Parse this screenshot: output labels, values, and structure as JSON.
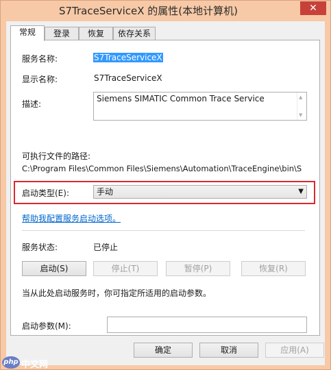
{
  "window": {
    "title": "S7TraceServiceX 的属性(本地计算机)",
    "close_glyph": "✕"
  },
  "tabs": [
    {
      "label": "常规",
      "active": true
    },
    {
      "label": "登录",
      "active": false
    },
    {
      "label": "恢复",
      "active": false
    },
    {
      "label": "依存关系",
      "active": false
    }
  ],
  "general": {
    "service_name_label": "服务名称:",
    "service_name_value": "S7TraceServiceX",
    "display_name_label": "显示名称:",
    "display_name_value": "S7TraceServiceX",
    "description_label": "描述:",
    "description_value": "Siemens SIMATIC Common Trace Service",
    "exe_path_label": "可执行文件的路径:",
    "exe_path_value": "C:\\Program Files\\Common Files\\Siemens\\Automation\\TraceEngine\\bin\\S",
    "startup_type_label": "启动类型(E):",
    "startup_type_value": "手动",
    "help_link": "帮助我配置服务启动选项。",
    "status_label": "服务状态:",
    "status_value": "已停止",
    "start_button": "启动(S)",
    "stop_button": "停止(T)",
    "pause_button": "暂停(P)",
    "resume_button": "恢复(R)",
    "hint_text": "当从此处启动服务时，你可指定所适用的启动参数。",
    "start_params_label": "启动参数(M):",
    "start_params_value": ""
  },
  "footer": {
    "ok_button": "确定",
    "cancel_button": "取消",
    "apply_button": "应用(A)"
  },
  "watermark": {
    "badge": "php",
    "text": "中文网"
  },
  "colors": {
    "accent_highlight": "#d9282f",
    "link": "#0066cc",
    "selection": "#3399ff",
    "close": "#c7413a"
  }
}
